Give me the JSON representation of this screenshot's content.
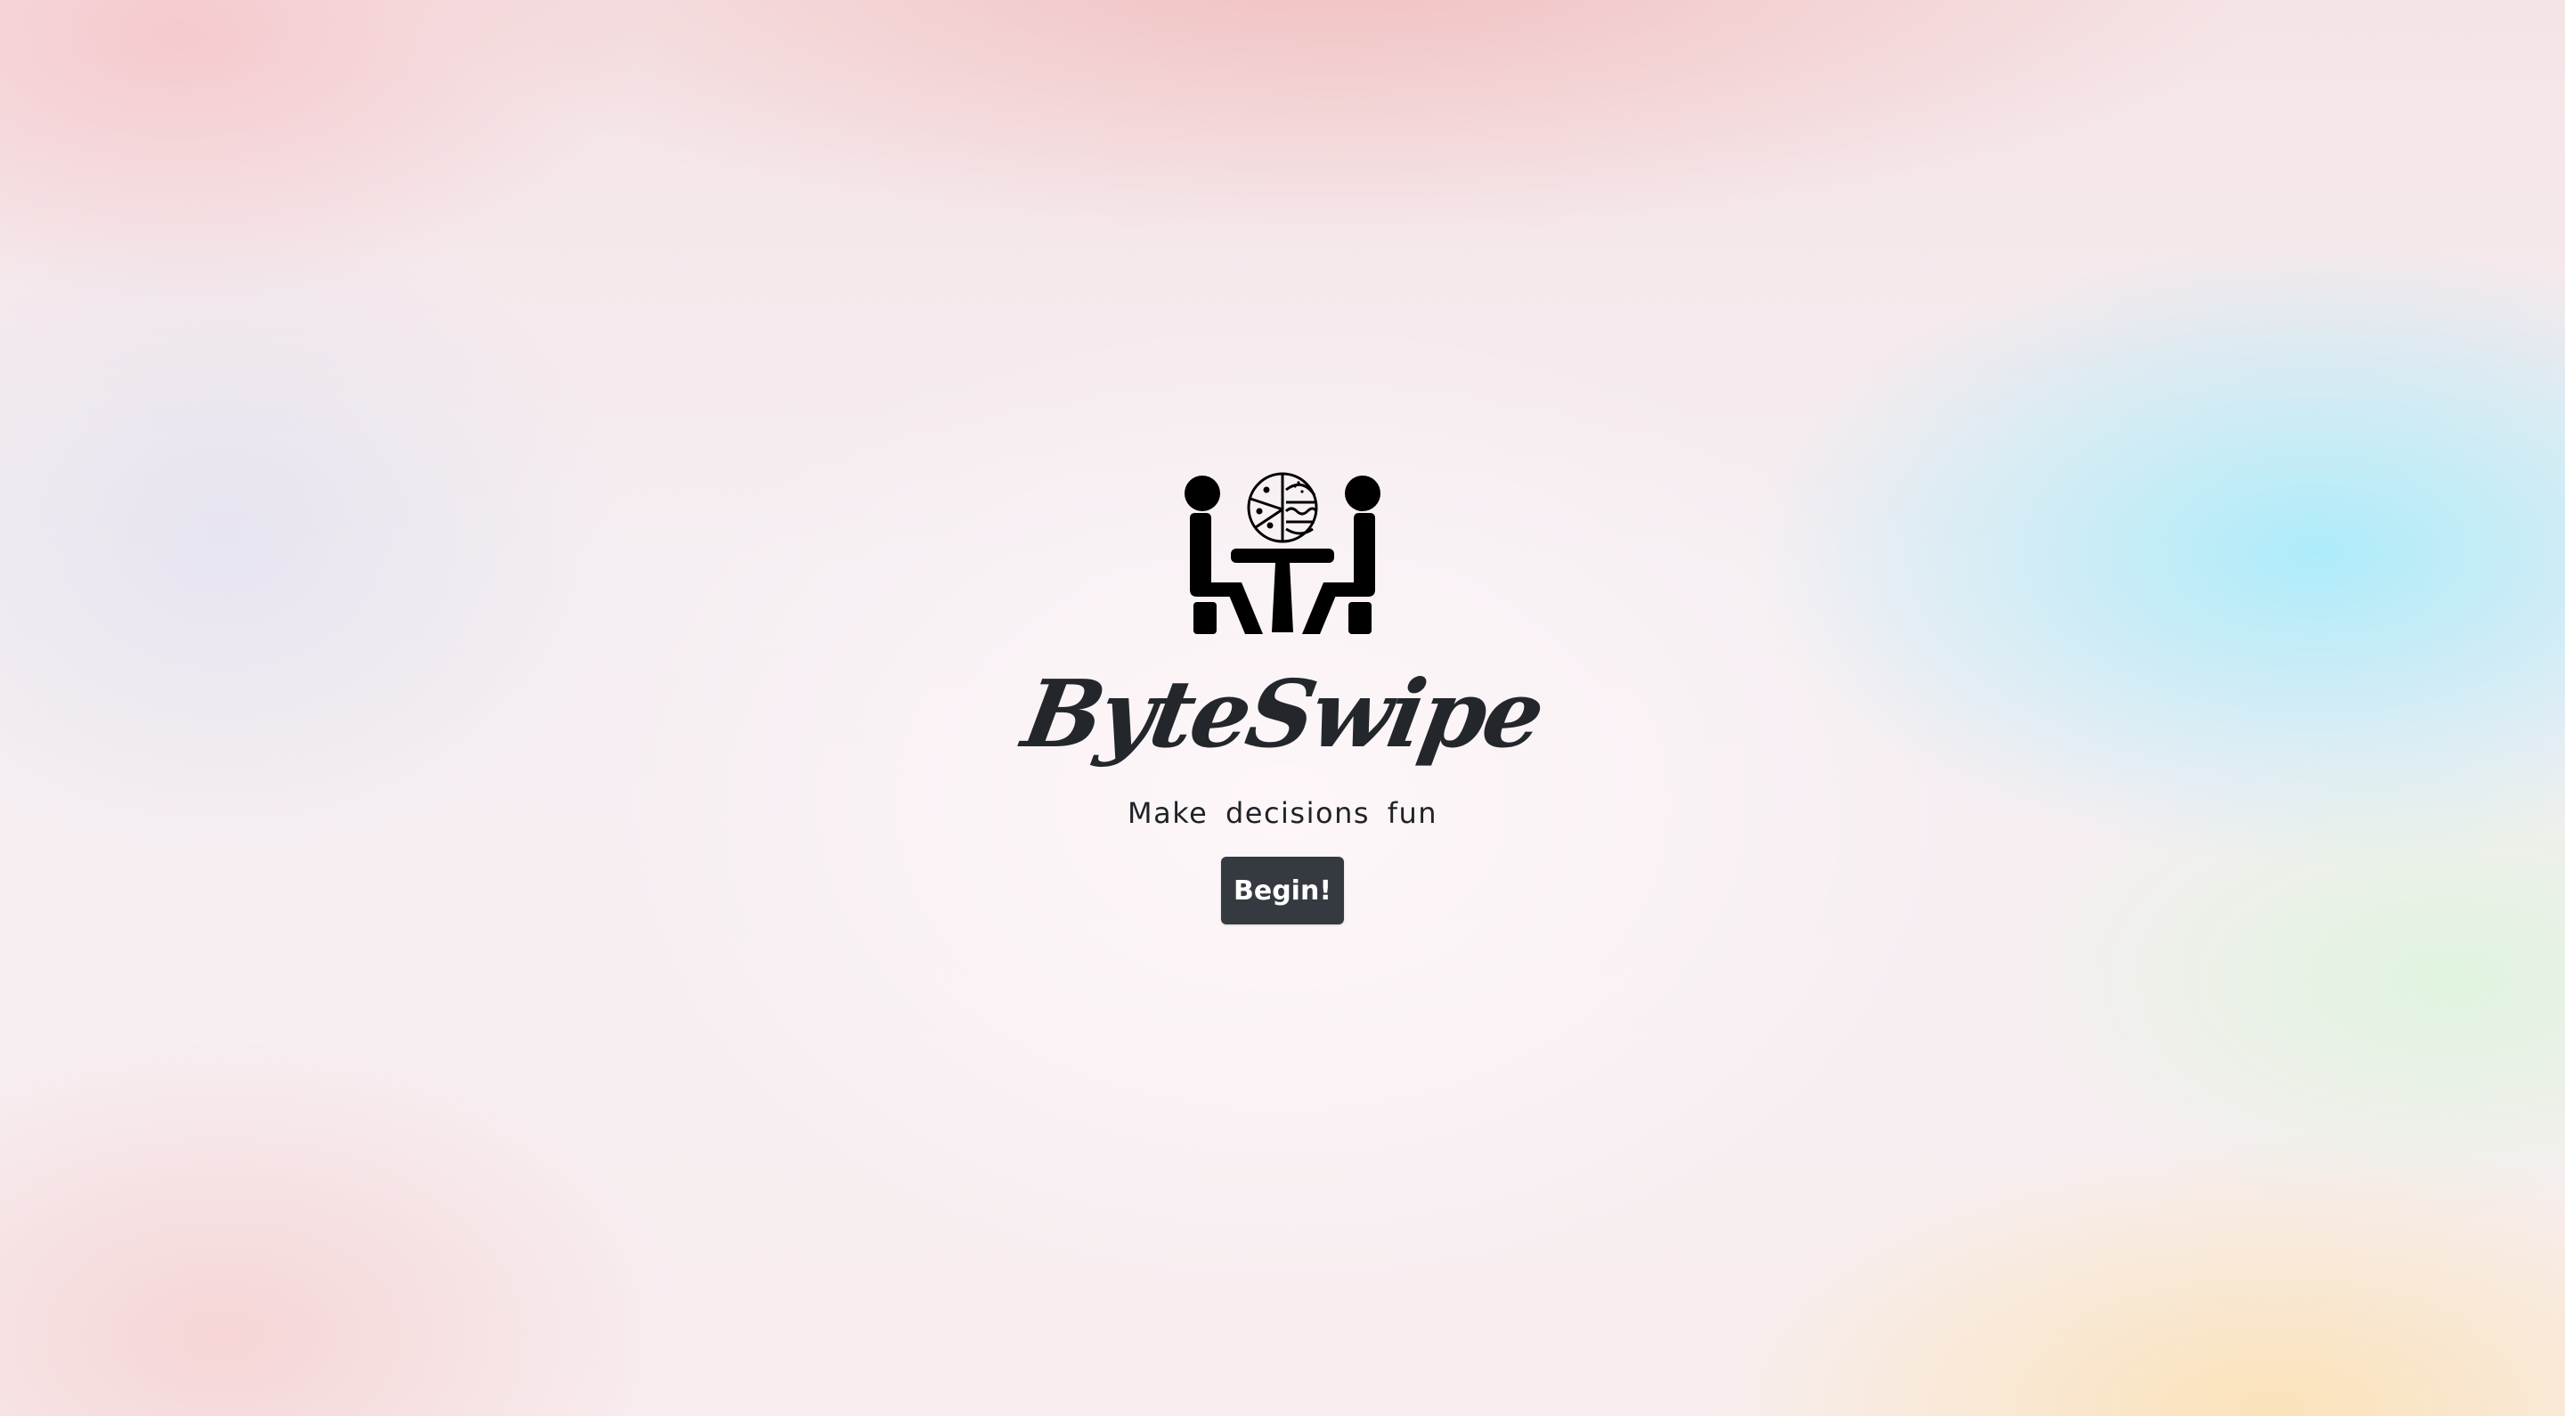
{
  "brand": {
    "logo_icon": "two-people-at-table-with-food-icon",
    "name": "ByteSwipe"
  },
  "hero": {
    "tagline": "Make decisions fun",
    "begin_label": "Begin!"
  },
  "colors": {
    "text": "#23272b",
    "button_bg": "#343a40",
    "button_text": "#ffffff"
  }
}
